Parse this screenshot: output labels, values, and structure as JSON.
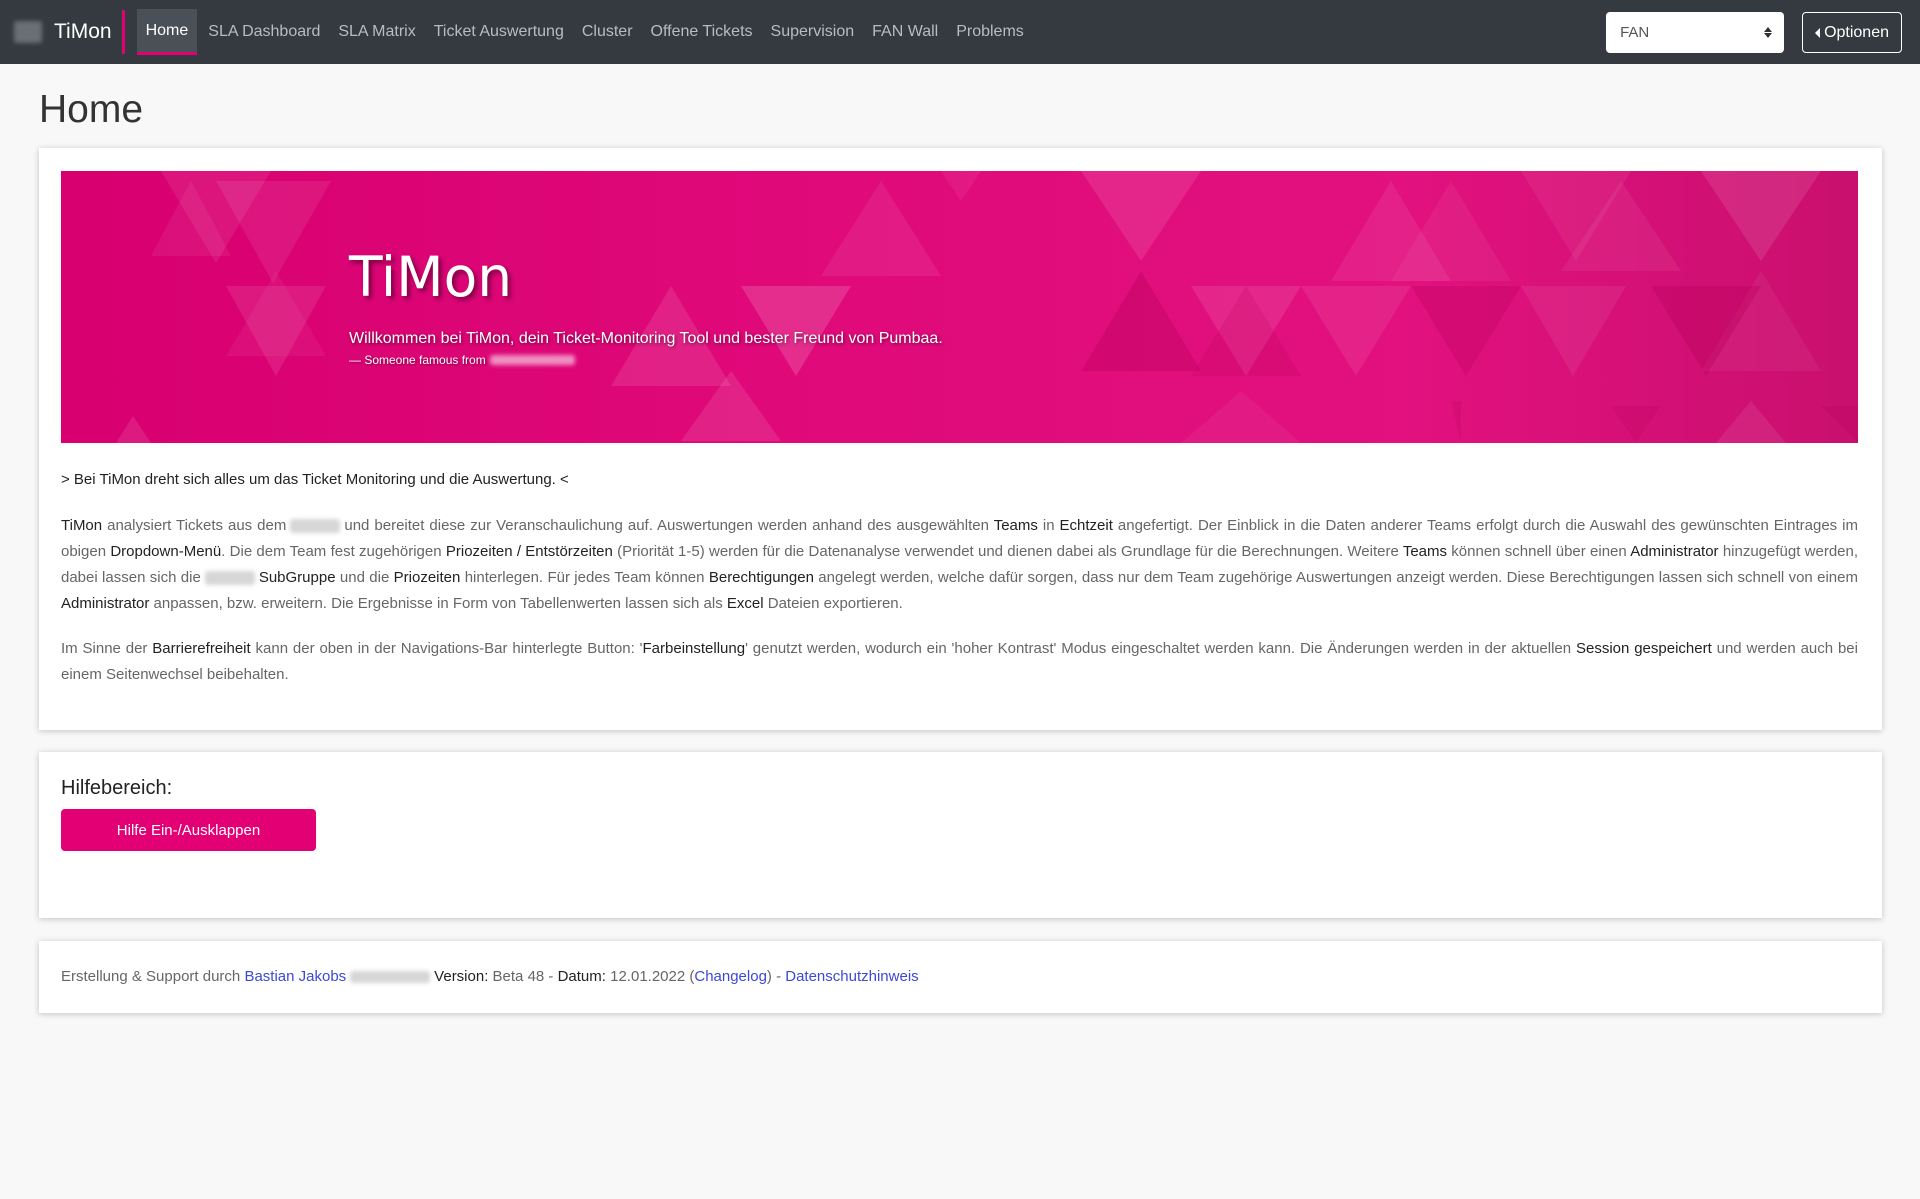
{
  "nav": {
    "brand": "TiMon",
    "items": [
      {
        "label": "Home",
        "active": true
      },
      {
        "label": "SLA Dashboard"
      },
      {
        "label": "SLA Matrix"
      },
      {
        "label": "Ticket Auswertung"
      },
      {
        "label": "Cluster"
      },
      {
        "label": "Offene Tickets"
      },
      {
        "label": "Supervision"
      },
      {
        "label": "FAN Wall"
      },
      {
        "label": "Problems"
      }
    ],
    "team_select": "FAN",
    "options_label": "Optionen"
  },
  "page_title": "Home",
  "hero": {
    "title": "TiMon",
    "subtitle": "Willkommen bei TiMon, dein Ticket-Monitoring Tool und bester Freund von Pumbaa.",
    "quote": "— Someone famous from"
  },
  "intro": "> Bei TiMon dreht sich alles um das Ticket Monitoring und die Auswertung. <",
  "paragraph1": {
    "s1": "TiMon",
    "s2": " analysiert Tickets aus dem",
    "s3": "und bereitet diese zur Veranschaulichung auf. Auswertungen werden anhand des ausgewählten ",
    "s4": "Teams",
    "s5": " in ",
    "s6": "Echtzeit",
    "s7": " angefertigt. Der Einblick in die Daten anderer Teams erfolgt durch die Auswahl des gewünschten Eintrages im obigen ",
    "s8": "Dropdown-Menü",
    "s9": ". Die dem Team fest zugehörigen ",
    "s10": "Priozeiten / Entstörzeiten",
    "s11": " (Priorität 1-5) werden für die Datenanalyse verwendet und dienen dabei als Grundlage für die Berechnungen. Weitere ",
    "s12": "Teams",
    "s13": " können schnell über einen ",
    "s14": "Administrator",
    "s15": " hinzugefügt werden, dabei lassen sich die",
    "s16": "SubGruppe",
    "s17": " und die ",
    "s18": "Priozeiten",
    "s19": " hinterlegen. Für jedes Team können ",
    "s20": "Berechtigungen",
    "s21": " angelegt werden, welche dafür sorgen, dass nur dem Team zugehörige Auswertungen anzeigt werden. Diese Berechtigungen lassen sich schnell von einem ",
    "s22": "Administrator",
    "s23": " anpassen, bzw. erweitern. Die Ergebnisse in Form von Tabellenwerten lassen sich als ",
    "s24": "Excel",
    "s25": " Dateien exportieren."
  },
  "paragraph2": {
    "s1": "Im Sinne der ",
    "s2": "Barrierefreiheit",
    "s3": " kann der oben in der Navigations-Bar hinterlegte Button: '",
    "s4": "Farbeinstellung",
    "s5": "' genutzt werden, wodurch ein 'hoher Kontrast' Modus eingeschaltet werden kann. Die Änderungen werden in der aktuellen ",
    "s6": "Session gespeichert",
    "s7": " und werden auch bei einem Seitenwechsel beibehalten."
  },
  "help": {
    "title": "Hilfebereich:",
    "button": "Hilfe Ein-/Ausklappen"
  },
  "footer": {
    "prefix": "Erstellung & Support durch ",
    "author": "Bastian Jakobs",
    "version_label": "Version:",
    "version": " Beta 48 - ",
    "date_label": "Datum:",
    "date": " 12.01.2022 (",
    "changelog": "Changelog",
    "sep": ") - ",
    "privacy": "Datenschutzhinweis"
  },
  "colors": {
    "navbar": "#343a40",
    "accent": "#e20074",
    "link": "#3d48d6"
  }
}
